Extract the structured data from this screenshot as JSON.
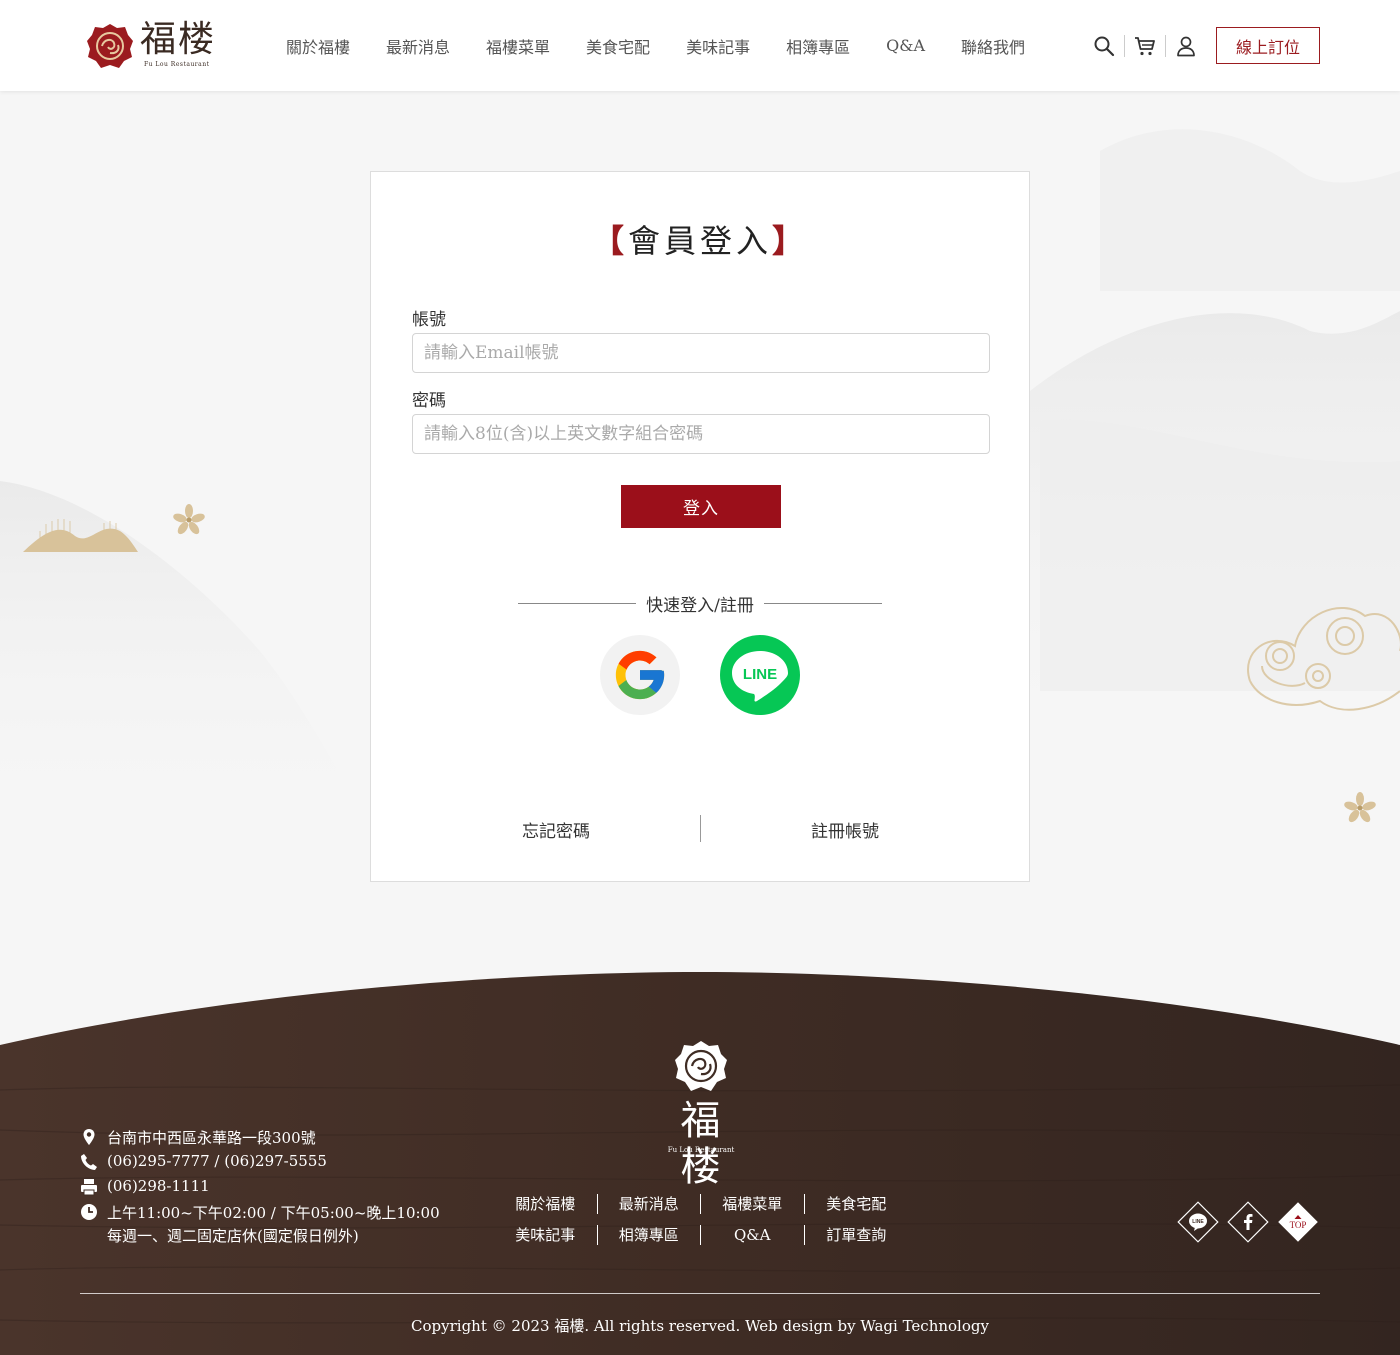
{
  "header": {
    "logo_text": "福楼",
    "logo_sub": "Fu Lou Restaurant",
    "nav": [
      "關於福樓",
      "最新消息",
      "福樓菜單",
      "美食宅配",
      "美味記事",
      "相簿專區",
      "Q&A",
      "聯絡我們"
    ],
    "icons": [
      "search-icon",
      "cart-icon",
      "user-icon"
    ],
    "reserve_label": "線上訂位"
  },
  "login": {
    "title_open": "【",
    "title": "會員登入",
    "title_close": "】",
    "account_label": "帳號",
    "account_placeholder": "請輸入Email帳號",
    "password_label": "密碼",
    "password_placeholder": "請輸入8位(含)以上英文數字組合密碼",
    "submit_label": "登入",
    "quick_label": "快速登入/註冊",
    "social": [
      "google-icon",
      "line-icon"
    ],
    "line_text": "LINE",
    "forgot_label": "忘記密碼",
    "register_label": "註冊帳號"
  },
  "footer": {
    "address": "台南市中西區永華路一段300號",
    "phone": "(06)295-7777 / (06)297-5555",
    "fax": "(06)298-1111",
    "hours": "上午11:00~下午02:00 / 下午05:00~晚上10:00",
    "closed": "每週一、週二固定店休(國定假日例外)",
    "logo_text": "福楼",
    "logo_sub": "Fu Lou Restaurant",
    "nav_row1": [
      "關於福樓",
      "最新消息",
      "福樓菜單",
      "美食宅配"
    ],
    "nav_row2": [
      "美味記事",
      "相簿專區",
      "Q&A",
      "訂單查詢"
    ],
    "social": [
      "line-icon",
      "facebook-icon",
      "top-icon"
    ],
    "line_text": "LINE",
    "top_label": "TOP",
    "copyright": "Copyright © 2023 福樓. All rights reserved. Web design by Wagi Technology"
  },
  "colors": {
    "brand_red": "#9b0f1a",
    "footer_wood": "#3d2a22",
    "gold": "#d8c29a"
  }
}
